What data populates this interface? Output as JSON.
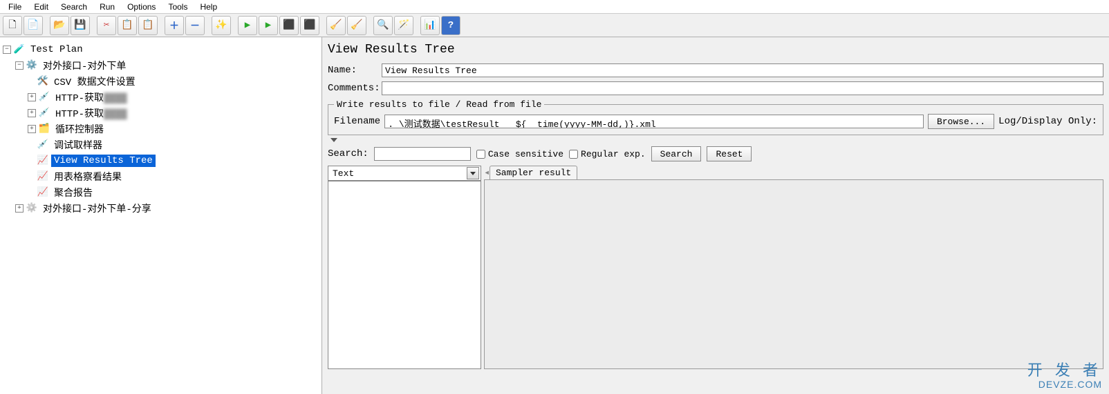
{
  "menu": {
    "file": "File",
    "edit": "Edit",
    "search": "Search",
    "run": "Run",
    "options": "Options",
    "tools": "Tools",
    "help": "Help"
  },
  "toolbar_icons": {
    "new": "🗋",
    "templates": "📄",
    "open": "📂",
    "save": "💾",
    "cut": "✂",
    "copy": "📋",
    "paste": "📋",
    "add": "＋",
    "remove": "－",
    "wand": "✨",
    "start": "▶",
    "start_no_timer": "▶",
    "stop": "⬛",
    "shutdown": "⬛",
    "clear": "🧹",
    "clear_all": "🧹",
    "search_btn": "🔍",
    "reset_search": "🪄",
    "fn_helper": "📊",
    "help": "?"
  },
  "tree": {
    "test_plan": "Test Plan",
    "thread_group": "对外接口-对外下单",
    "csv": "CSV 数据文件设置",
    "http1_prefix": "HTTP-获取",
    "http1_blur": "████",
    "http2_prefix": "HTTP-获取",
    "http2_blur": "████",
    "loop": "循环控制器",
    "debug": "调试取样器",
    "view_results": "View Results Tree",
    "table_view": "用表格察看结果",
    "aggregate": "聚合报告",
    "thread_group2": "对外接口-对外下单-分享"
  },
  "panel": {
    "title": "View Results Tree",
    "name_label": "Name:",
    "name_value": "View Results Tree",
    "comments_label": "Comments:",
    "comments_value": "",
    "fieldset_legend": "Write results to file / Read from file",
    "filename_label": "Filename",
    "filename_value": ".                                                 \\测试数据\\testResult_        _${__time(yyyy-MM-dd,)}.xml",
    "browse_btn": "Browse...",
    "log_display": "Log/Display Only:",
    "search_label": "Search:",
    "search_value": "",
    "case_sensitive": "Case sensitive",
    "regular_exp": "Regular exp.",
    "search_btn": "Search",
    "reset_btn": "Reset",
    "renderer": "Text",
    "tab_sampler": "Sampler result"
  },
  "watermark": {
    "cn": "开 发 者",
    "en": "DEVZE.COM"
  }
}
